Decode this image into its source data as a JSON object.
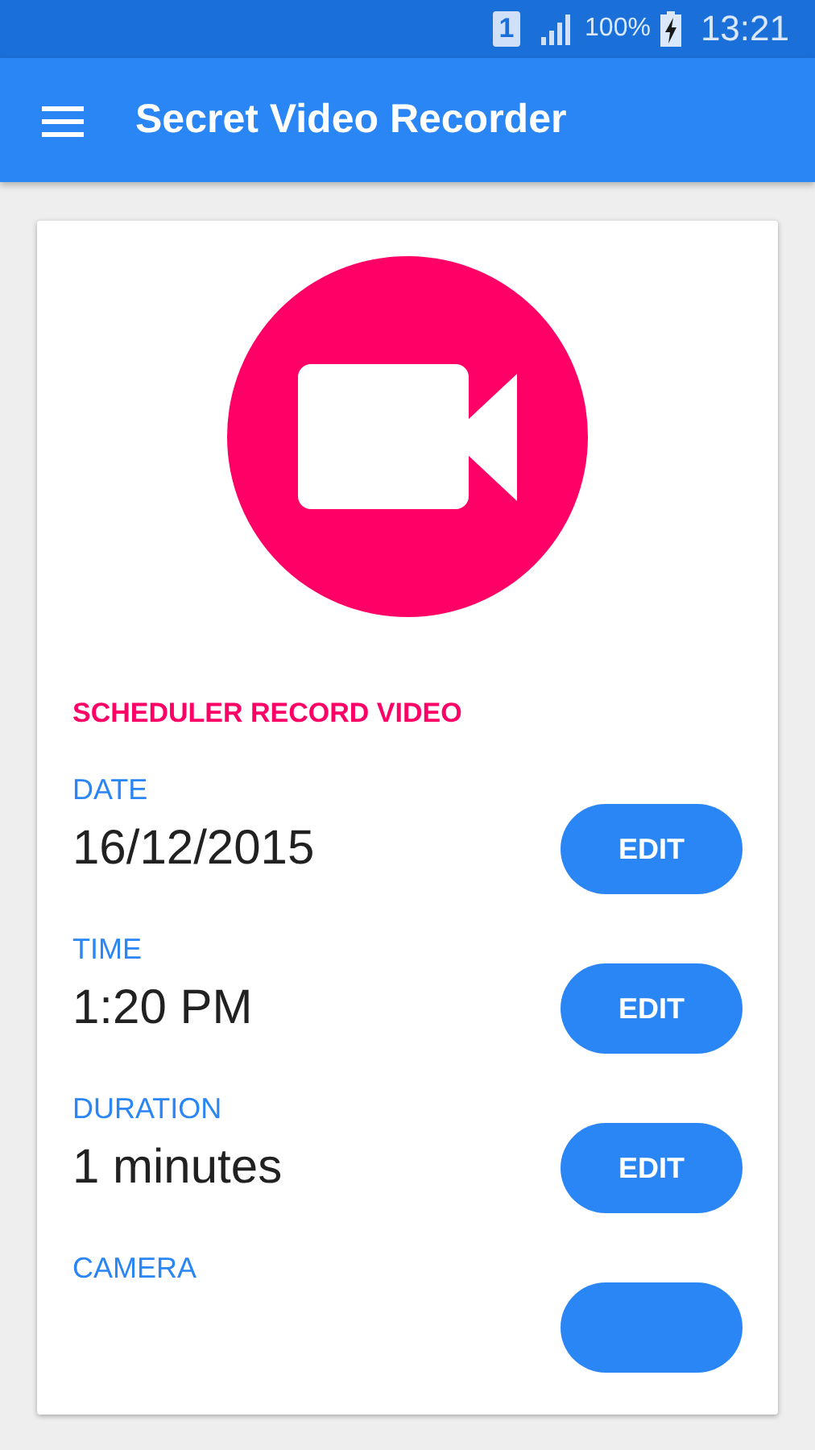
{
  "status_bar": {
    "sim": "1",
    "battery": "100%",
    "time": "13:21"
  },
  "app_bar": {
    "title": "Secret Video Recorder"
  },
  "card": {
    "section_title": "SCHEDULER RECORD VIDEO",
    "settings": [
      {
        "label": "DATE",
        "value": "16/12/2015",
        "button": "EDIT"
      },
      {
        "label": "TIME",
        "value": "1:20 PM",
        "button": "EDIT"
      },
      {
        "label": "DURATION",
        "value": "1 minutes",
        "button": "EDIT"
      },
      {
        "label": "CAMERA"
      }
    ]
  }
}
